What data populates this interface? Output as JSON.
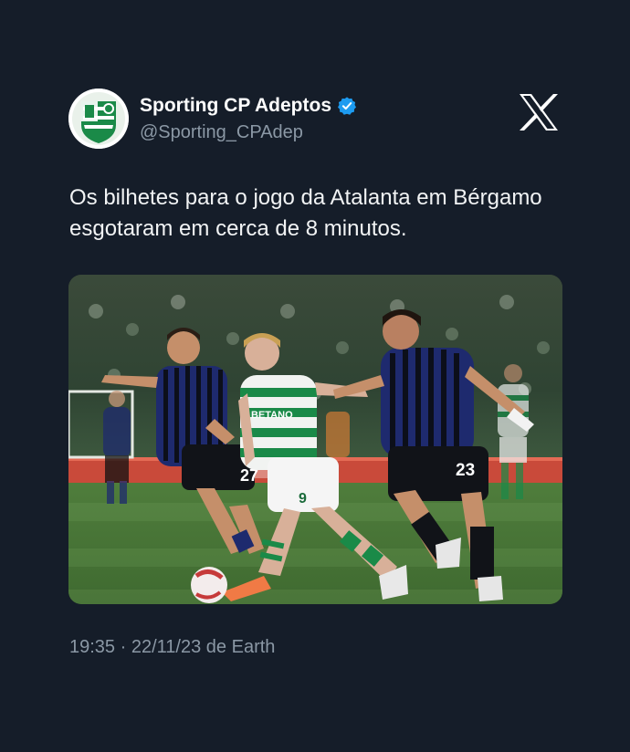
{
  "author": {
    "display_name": "Sporting CP Adeptos",
    "handle": "@Sporting_CPAdep",
    "verified": true,
    "avatar_icon": "sporting-crest-avatar"
  },
  "platform_logo": "x-logo-icon",
  "tweet": {
    "text": "Os bilhetes para o jogo da Atalanta em Bérgamo esgotaram em cerca de 8 minutos."
  },
  "media": {
    "kind": "photo",
    "description_icon": "football-match-photo",
    "jersey_numbers": [
      "27",
      "9",
      "23"
    ],
    "sponsor_text": "BETANO"
  },
  "meta": {
    "time": "19:35",
    "separator": "·",
    "date": "22/11/23",
    "source": "de Earth"
  },
  "colors": {
    "background": "#151d29",
    "verified": "#1d9bf0",
    "muted": "#8b98a5",
    "sporting_green": "#1a8a48",
    "atalanta_blue": "#1e2a6e"
  }
}
